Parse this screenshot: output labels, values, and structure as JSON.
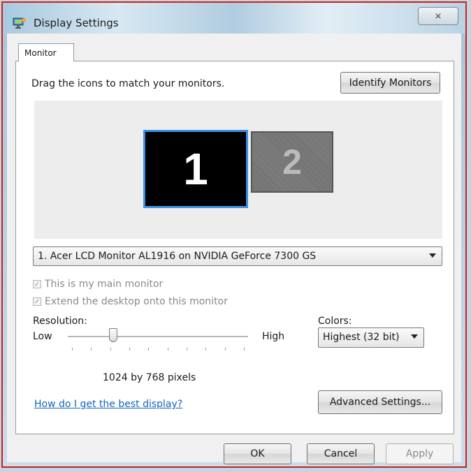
{
  "window": {
    "title": "Display Settings",
    "close_label": "⨯"
  },
  "tabs": [
    {
      "label": "Monitor",
      "active": true
    }
  ],
  "monitor_tab": {
    "instruction": "Drag the icons to match your monitors.",
    "identify_button": "Identify Monitors",
    "monitors": [
      {
        "number": "1",
        "selected": true
      },
      {
        "number": "2",
        "selected": false
      }
    ],
    "monitor_select": {
      "value": "1. Acer LCD Monitor AL1916 on NVIDIA GeForce 7300 GS"
    },
    "checkboxes": [
      {
        "label": "This is my main monitor",
        "checked": true,
        "enabled": false
      },
      {
        "label": "Extend the desktop onto this monitor",
        "checked": true,
        "enabled": false
      }
    ],
    "resolution": {
      "label": "Resolution:",
      "low": "Low",
      "high": "High",
      "value_text": "1024 by 768 pixels",
      "slider_position": 0.25,
      "tick_count": 10
    },
    "colors": {
      "label": "Colors:",
      "value": "Highest (32 bit)"
    },
    "help_link": "How do I get the best display?",
    "advanced_button": "Advanced Settings..."
  },
  "footer": {
    "ok": "OK",
    "cancel": "Cancel",
    "apply": "Apply"
  },
  "colors_theme": {
    "selected_border": "#3a8ee6",
    "link": "#1565c0",
    "window_border": "#cc1f1f"
  }
}
